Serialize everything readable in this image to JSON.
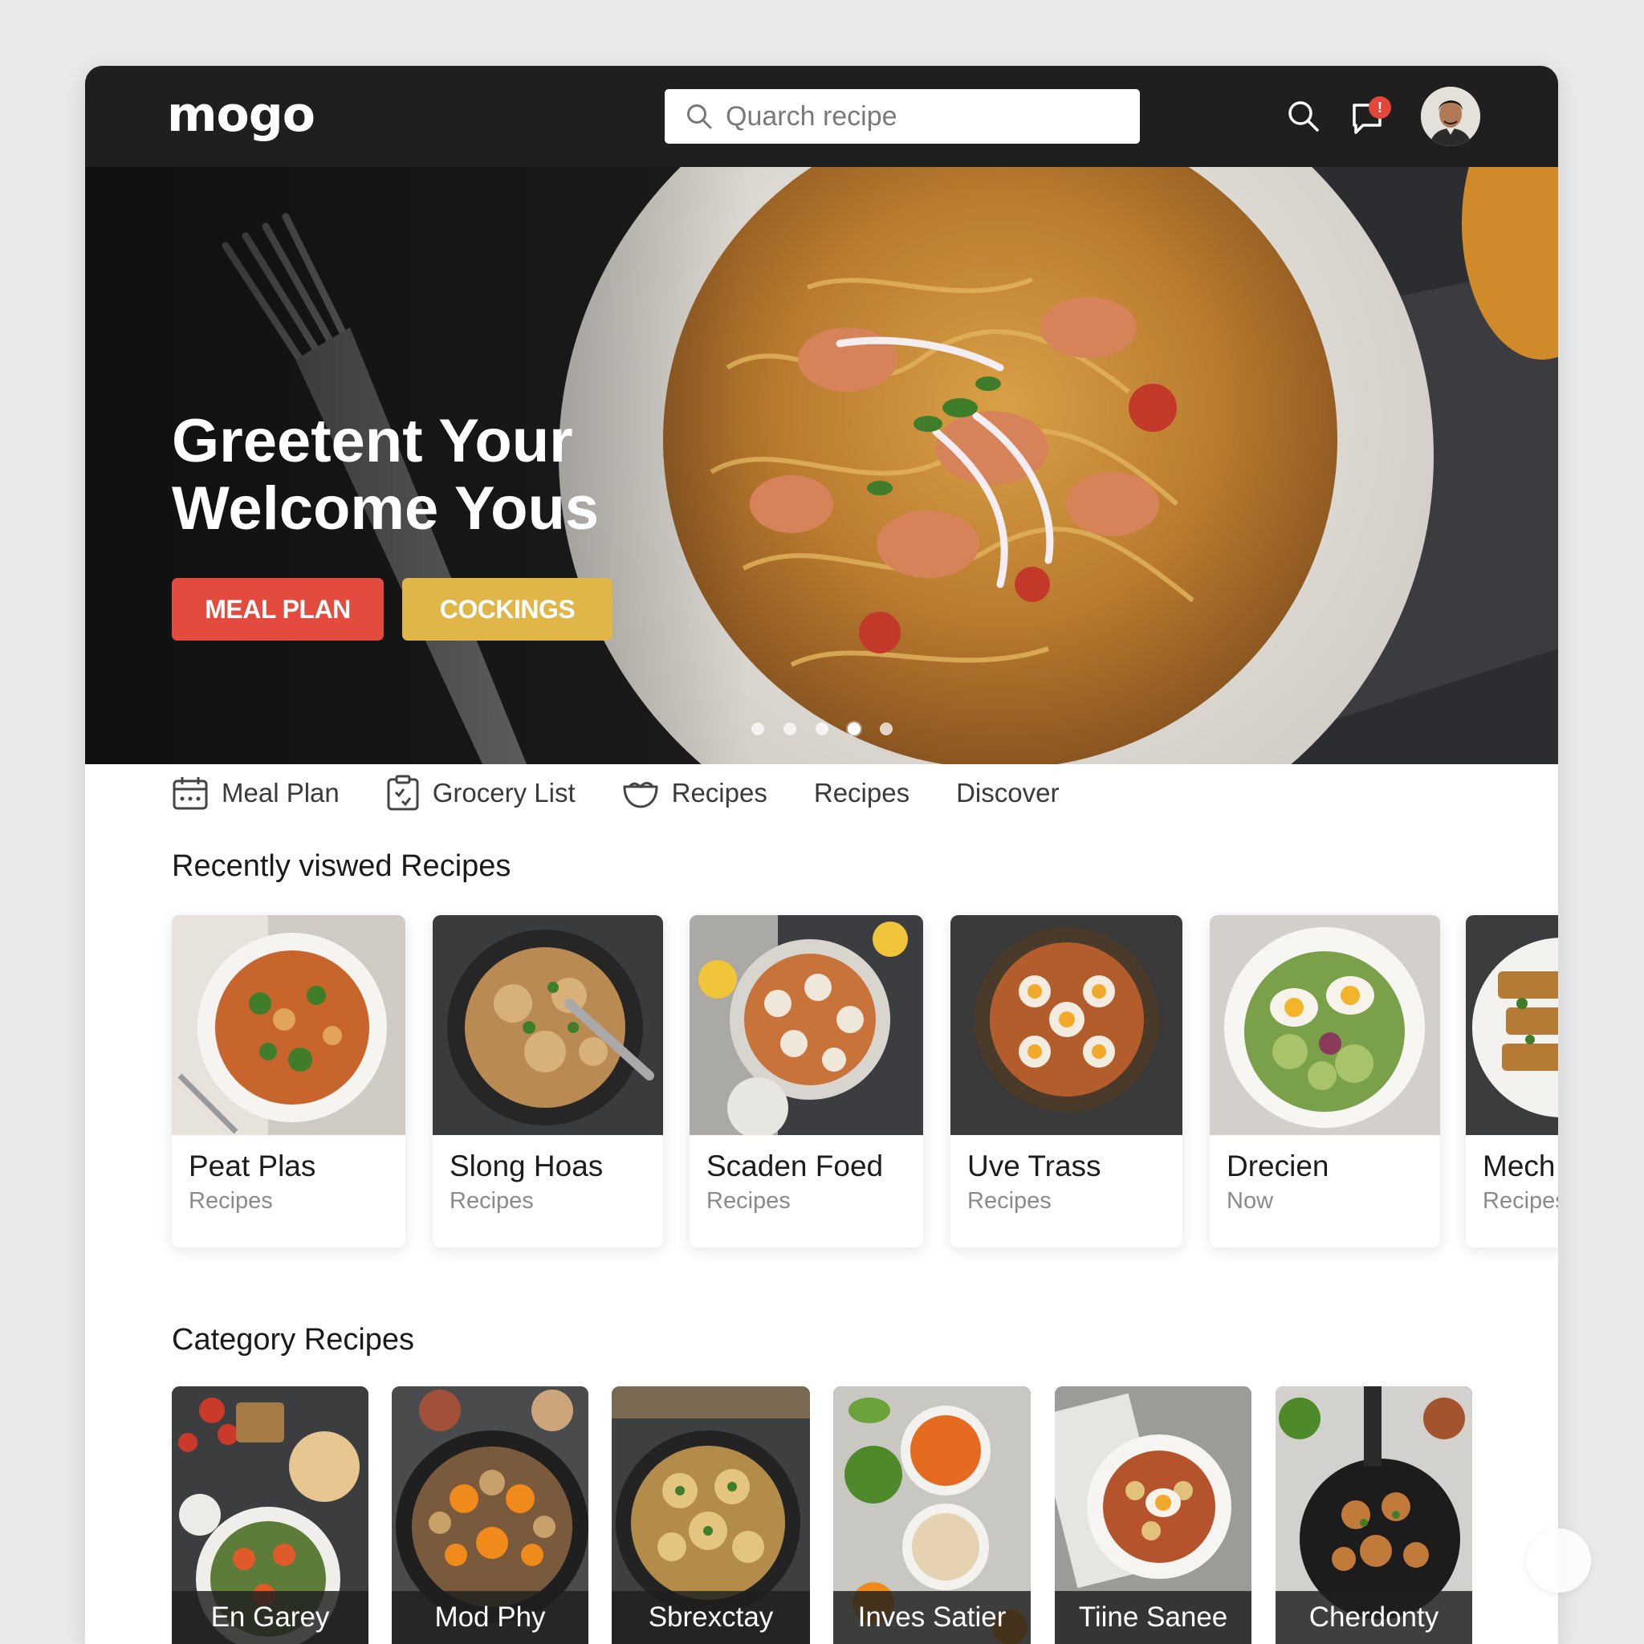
{
  "header": {
    "logo": "mogo",
    "search_placeholder": "Quarch recipe",
    "notification_badge": "!"
  },
  "hero": {
    "title_line1": "Greetent Your",
    "title_line2": "Welcome Yous",
    "meal_plan_label": "MEAL PLAN",
    "cookings_label": "COCKINGS",
    "carousel": {
      "count": 5,
      "active_index": 3
    }
  },
  "nav": {
    "items": [
      {
        "label": "Meal Plan",
        "icon": "calendar-icon"
      },
      {
        "label": "Grocery List",
        "icon": "grocery-list-icon"
      },
      {
        "label": "Recipes",
        "icon": "bowl-icon"
      },
      {
        "label": "Recipes"
      },
      {
        "label": "Discover"
      }
    ]
  },
  "recent": {
    "title": "Recently viswed Recipes",
    "items": [
      {
        "title": "Peat Plas",
        "subtitle": "Recipes"
      },
      {
        "title": "Slong Hoas",
        "subtitle": "Recipes"
      },
      {
        "title": "Scaden Foed",
        "subtitle": "Recipes"
      },
      {
        "title": "Uve Trass",
        "subtitle": "Recipes"
      },
      {
        "title": "Drecien",
        "subtitle": "Now"
      },
      {
        "title": "Mech",
        "subtitle": "Recipes"
      }
    ]
  },
  "category": {
    "title": "Category Recipes",
    "items": [
      {
        "label": "En Garey"
      },
      {
        "label": "Mod Phy"
      },
      {
        "label": "Sbrexctay"
      },
      {
        "label": "Inves Satier"
      },
      {
        "label": "Tiine Sanee"
      },
      {
        "label": "Cherdonty"
      }
    ]
  },
  "colors": {
    "topbar": "#1f1f1f",
    "meal_plan_button": "#e24b3d",
    "cookings_button": "#e0b648",
    "notification_badge": "#e5463a"
  }
}
